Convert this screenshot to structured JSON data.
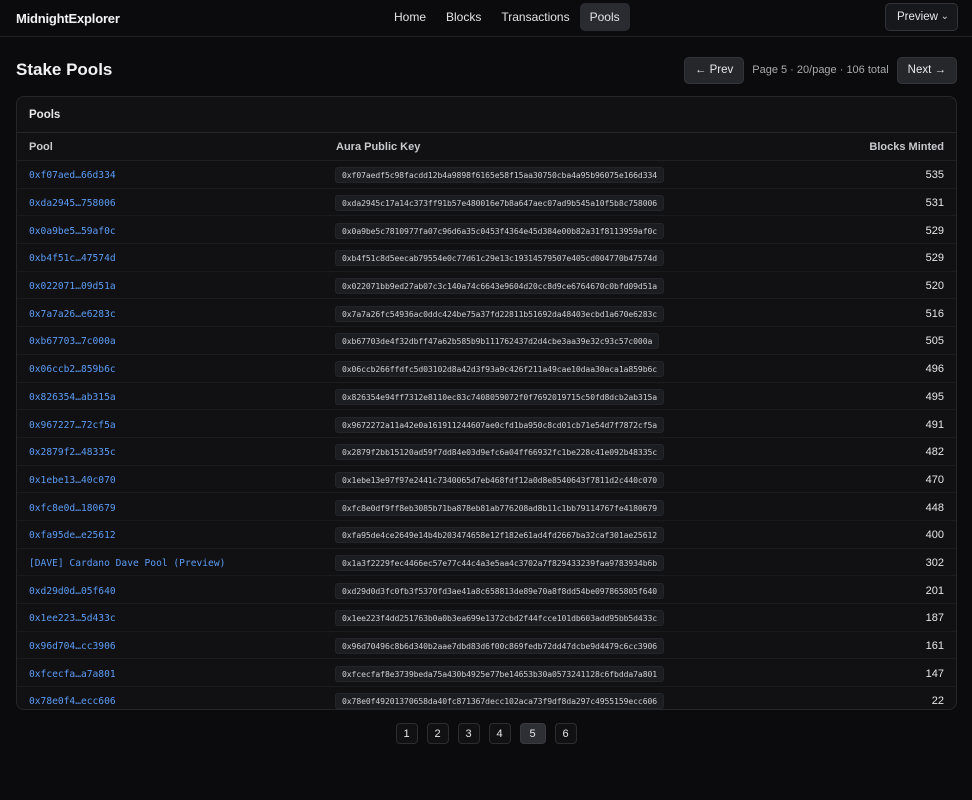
{
  "app": {
    "brand": "MidnightExplorer"
  },
  "nav": [
    {
      "label": "Home",
      "active": false
    },
    {
      "label": "Blocks",
      "active": false
    },
    {
      "label": "Transactions",
      "active": false
    },
    {
      "label": "Pools",
      "active": true
    }
  ],
  "network_select": {
    "value": "Preview"
  },
  "page": {
    "title": "Stake Pools"
  },
  "pager_top": {
    "prev_label": "← Prev",
    "info": "Page 5 · 20/page · 106 total",
    "next_label": "Next →"
  },
  "card": {
    "title": "Pools"
  },
  "table": {
    "headers": {
      "pool": "Pool",
      "key": "Aura Public Key",
      "blocks": "Blocks Minted"
    },
    "rows": [
      {
        "pool": "0xf07aed…66d334",
        "key": "0xf07aedf5c98facdd12b4a9898f6165e58f15aa30750cba4a95b96075e166d334",
        "blocks": "535"
      },
      {
        "pool": "0xda2945…758006",
        "key": "0xda2945c17a14c373ff91b57e480016e7b8a647aec07ad9b545a10f5b8c758006",
        "blocks": "531"
      },
      {
        "pool": "0x0a9be5…59af0c",
        "key": "0x0a9be5c7810977fa07c96d6a35c0453f4364e45d384e00b82a31f8113959af0c",
        "blocks": "529"
      },
      {
        "pool": "0xb4f51c…47574d",
        "key": "0xb4f51c8d5eecab79554e0c77d61c29e13c19314579507e405cd004770b47574d",
        "blocks": "529"
      },
      {
        "pool": "0x022071…09d51a",
        "key": "0x022071bb9ed27ab07c3c140a74c6643e9604d20cc8d9ce6764670c0bfd09d51a",
        "blocks": "520"
      },
      {
        "pool": "0x7a7a26…e6283c",
        "key": "0x7a7a26fc54936ac0ddc424be75a37fd22811b51692da48403ecbd1a670e6283c",
        "blocks": "516"
      },
      {
        "pool": "0xb67703…7c000a",
        "key": "0xb67703de4f32dbff47a62b585b9b111762437d2d4cbe3aa39e32c93c57c000a",
        "blocks": "505"
      },
      {
        "pool": "0x06ccb2…859b6c",
        "key": "0x06ccb266ffdfc5d03102d8a42d3f93a9c426f211a49cae10daa30aca1a859b6c",
        "blocks": "496"
      },
      {
        "pool": "0x826354…ab315a",
        "key": "0x826354e94ff7312e8110ec83c7408059072f0f7692019715c50fd8dcb2ab315a",
        "blocks": "495"
      },
      {
        "pool": "0x967227…72cf5a",
        "key": "0x9672272a11a42e0a161911244607ae0cfd1ba950c8cd01cb71e54d7f7872cf5a",
        "blocks": "491"
      },
      {
        "pool": "0x2879f2…48335c",
        "key": "0x2879f2bb15120ad59f7dd84e03d9efc6a04ff66932fc1be228c41e092b48335c",
        "blocks": "482"
      },
      {
        "pool": "0x1ebe13…40c070",
        "key": "0x1ebe13e97f97e2441c7340065d7eb468fdf12a0d8e8540643f7811d2c440c070",
        "blocks": "470"
      },
      {
        "pool": "0xfc8e0d…180679",
        "key": "0xfc8e0df9ff8eb3085b71ba878eb81ab776208ad8b11c1bb79114767fe4180679",
        "blocks": "448"
      },
      {
        "pool": "0xfa95de…e25612",
        "key": "0xfa95de4ce2649e14b4b203474658e12f182e61ad4fd2667ba32caf301ae25612",
        "blocks": "400"
      },
      {
        "pool": "[DAVE] Cardano Dave Pool (Preview)",
        "key": "0x1a3f2229fec4466ec57e77c44c4a3e5aa4c3702a7f829433239faa9783934b6b",
        "blocks": "302"
      },
      {
        "pool": "0xd29d0d…05f640",
        "key": "0xd29d0d3fc0fb3f5370fd3ae41a8c658813de89e70a8f8dd54be097865805f640",
        "blocks": "201"
      },
      {
        "pool": "0x1ee223…5d433c",
        "key": "0x1ee223f4dd251763b0a0b3ea699e1372cbd2f44fcce101db603add95bb5d433c",
        "blocks": "187"
      },
      {
        "pool": "0x96d704…cc3906",
        "key": "0x96d70496c8b6d340b2aae7dbd83d6f00c869fedb72dd47dcbe9d4479c6cc3906",
        "blocks": "161"
      },
      {
        "pool": "0xfcecfa…a7a801",
        "key": "0xfcecfaf8e3739beda75a430b4925e77be14653b30a0573241128c6fbdda7a801",
        "blocks": "147"
      },
      {
        "pool": "0x78e0f4…ecc606",
        "key": "0x78e0f49201370658da40fc871367decc102aca73f9df8da297c4955159ecc606",
        "blocks": "22"
      }
    ]
  },
  "pagination": {
    "pages": [
      "1",
      "2",
      "3",
      "4",
      "5",
      "6"
    ],
    "current": "5"
  }
}
